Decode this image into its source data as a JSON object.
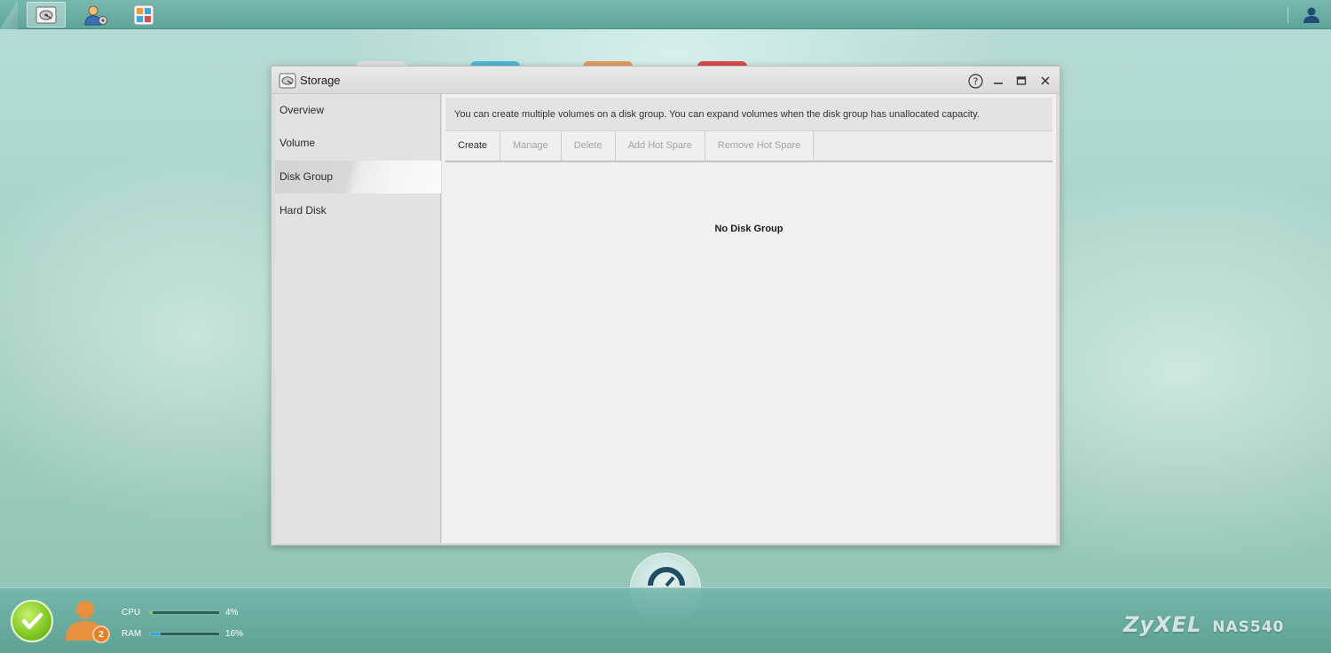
{
  "window": {
    "title": "Storage"
  },
  "sidebar": {
    "items": [
      {
        "label": "Overview"
      },
      {
        "label": "Volume"
      },
      {
        "label": "Disk Group"
      },
      {
        "label": "Hard Disk"
      }
    ],
    "selected": "Disk Group"
  },
  "content": {
    "info": "You can create multiple volumes on a disk group. You can expand volumes when the disk group has unallocated capacity.",
    "toolbar": [
      {
        "label": "Create",
        "enabled": true
      },
      {
        "label": "Manage",
        "enabled": false
      },
      {
        "label": "Delete",
        "enabled": false
      },
      {
        "label": "Add Hot Spare",
        "enabled": false
      },
      {
        "label": "Remove Hot Spare",
        "enabled": false
      }
    ],
    "empty_message": "No Disk Group"
  },
  "status": {
    "user_count": "2",
    "cpu": {
      "label": "CPU",
      "value": "4%",
      "fraction": 0.04,
      "color": "#9ad21c"
    },
    "ram": {
      "label": "RAM",
      "value": "16%",
      "fraction": 0.16,
      "color": "#3aa6e8"
    }
  },
  "brand": {
    "logo": "ZyXEL",
    "model": "NAS540"
  },
  "icons": {
    "top_apps": [
      "storage-manager-icon",
      "user-settings-icon",
      "app-center-icon"
    ],
    "user": "user-account-icon",
    "window_controls": [
      "help-icon",
      "minimize-icon",
      "maximize-icon",
      "close-icon"
    ],
    "status": "status-ok-icon",
    "dock": "dashboard-gauge-icon"
  },
  "colors": {
    "accent_teal": "#5fa49a",
    "ok_green": "#7fc522",
    "user_badge": "#e0812b"
  }
}
